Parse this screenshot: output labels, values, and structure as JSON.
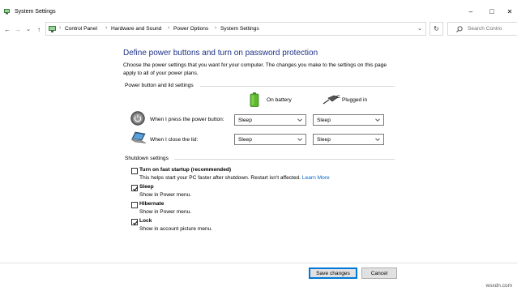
{
  "window": {
    "title": "System Settings",
    "controls": {
      "minimize": "–",
      "maximize": "□",
      "close": "✕"
    }
  },
  "nav": {
    "back": "←",
    "forward": "→",
    "recent": "⌄",
    "up": "↑",
    "breadcrumb": [
      "Control Panel",
      "Hardware and Sound",
      "Power Options",
      "System Settings"
    ],
    "dropdown": "⌄",
    "refresh": "↻",
    "search_placeholder": "Search Contro"
  },
  "main": {
    "heading": "Define power buttons and turn on password protection",
    "intro": "Choose the power settings that you want for your computer. The changes you make to the settings on this page apply to all of your power plans.",
    "power_section": {
      "label": "Power button and lid settings",
      "columns": {
        "battery": "On battery",
        "plugged": "Plugged in"
      },
      "rows": [
        {
          "label": "When I press the power button:",
          "battery": "Sleep",
          "plugged": "Sleep"
        },
        {
          "label": "When I close the lid:",
          "battery": "Sleep",
          "plugged": "Sleep"
        }
      ]
    },
    "shutdown_section": {
      "label": "Shutdown settings",
      "options": [
        {
          "title": "Turn on fast startup (recommended)",
          "description": "This helps start your PC faster after shutdown. Restart isn't affected.",
          "link": "Learn More",
          "checked": false
        },
        {
          "title": "Sleep",
          "description": "Show in Power menu.",
          "checked": true
        },
        {
          "title": "Hibernate",
          "description": "Show in Power menu.",
          "checked": false
        },
        {
          "title": "Lock",
          "description": "Show in account picture menu.",
          "checked": true
        }
      ]
    }
  },
  "footer": {
    "save": "Save changes",
    "cancel": "Cancel"
  },
  "watermark": "wsxdn.com",
  "colors": {
    "heading": "#1e3287",
    "link": "#0066cc",
    "primary_border": "#0078d7"
  }
}
